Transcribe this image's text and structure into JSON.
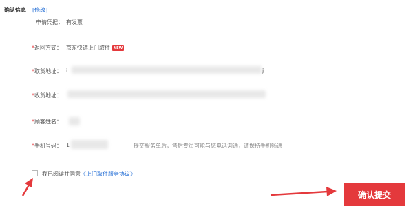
{
  "section": {
    "title": "确认信息",
    "edit_link": "[修改]"
  },
  "fields": {
    "voucher": {
      "label": "申请凭据：",
      "value": "有发票"
    },
    "return_method": {
      "required_mark": "*",
      "label": "返回方式：",
      "value": "京东快递上门取件",
      "badge": "NEW"
    },
    "pickup_address": {
      "required_mark": "*",
      "label": "取货地址：",
      "value_prefix": "i",
      "value_suffix": "j"
    },
    "delivery_address": {
      "required_mark": "*",
      "label": "收货地址："
    },
    "customer_name": {
      "required_mark": "*",
      "label": "顾客姓名："
    },
    "phone": {
      "required_mark": "*",
      "label": "手机号码：",
      "value_prefix": "1",
      "hint": "提交服务单后，售后专员可能与您电话沟通，请保持手机畅通"
    }
  },
  "agreement": {
    "checked": false,
    "text": "我已阅读并同意",
    "link": "《上门取件服务协议》"
  },
  "submit": {
    "label": "确认提交"
  },
  "colors": {
    "accent": "#e4393c",
    "link": "#1e6ad4",
    "annotation_arrow": "#e4393c"
  }
}
